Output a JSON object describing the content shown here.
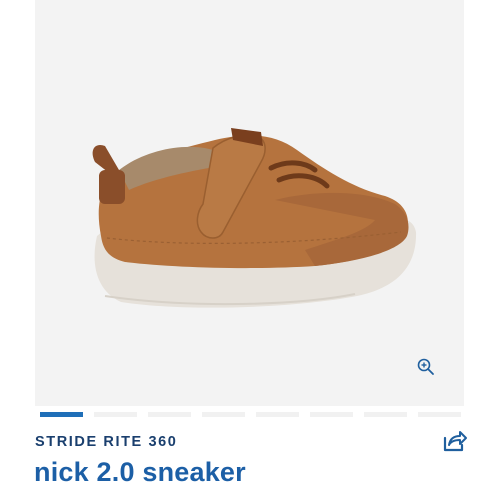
{
  "product": {
    "brand": "STRIDE RITE 360",
    "name": "nick 2.0 sneaker",
    "image_alt": "brown toddler sneaker side view"
  },
  "gallery": {
    "slide_count": 8,
    "active_index": 0
  },
  "icons": {
    "zoom": "zoom-in-icon",
    "share": "share-icon"
  },
  "colors": {
    "accent": "#1f6fb8",
    "brand_text": "#1a3f6e",
    "title_text": "#1c5fa6",
    "image_background": "#f3f3f3"
  }
}
